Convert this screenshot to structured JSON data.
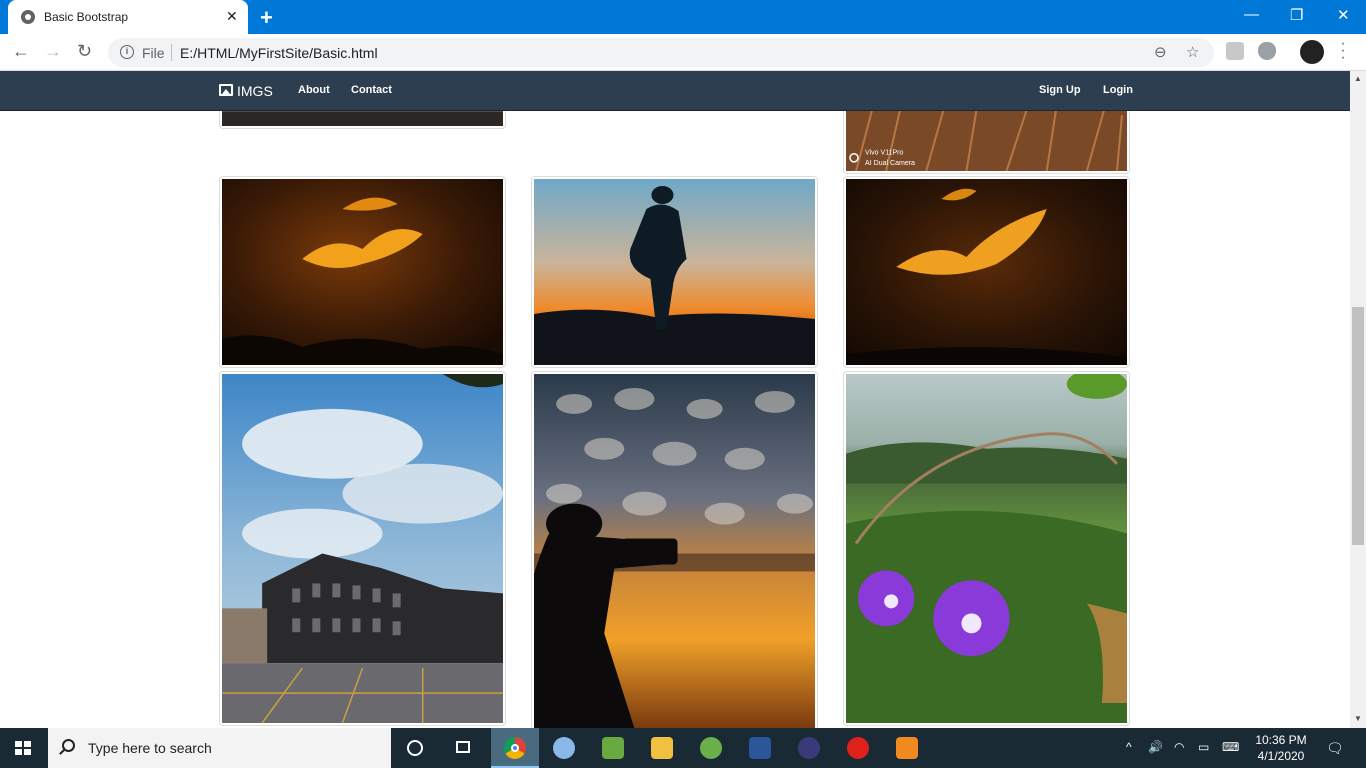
{
  "browser": {
    "tab_title": "Basic Bootstrap",
    "tab_close": "✕",
    "new_tab": "+",
    "url_scheme_label": "File",
    "url": "E:/HTML/MyFirstSite/Basic.html",
    "window_controls": {
      "minimize": "—",
      "restore": "❐",
      "close": "✕"
    },
    "nav": {
      "back": "←",
      "forward": "→",
      "reload": "↻"
    },
    "icons": {
      "zoom": "⊖",
      "star": "☆"
    }
  },
  "site": {
    "brand": "IMGS",
    "nav_left": [
      "About",
      "Contact"
    ],
    "nav_right": [
      "Sign Up",
      "Login"
    ],
    "photo_caption": "Vivo V11Pro\nAI Dual Camera",
    "photos": [
      "sunset-clouds-rays",
      "silhouette-person-sunset",
      "sunset-clouds-rays-2",
      "historic-building-sky",
      "photographer-silhouette-clouds",
      "purple-morning-glory-flowers"
    ]
  },
  "taskbar": {
    "search_placeholder": "Type here to search",
    "apps": [
      "cortana",
      "task-view",
      "chrome",
      "paint",
      "notepad",
      "file-explorer",
      "spring-tool",
      "word",
      "eclipse",
      "opera",
      "sublime-text"
    ],
    "active_app": "chrome",
    "time": "10:36 PM",
    "date": "4/1/2020"
  }
}
